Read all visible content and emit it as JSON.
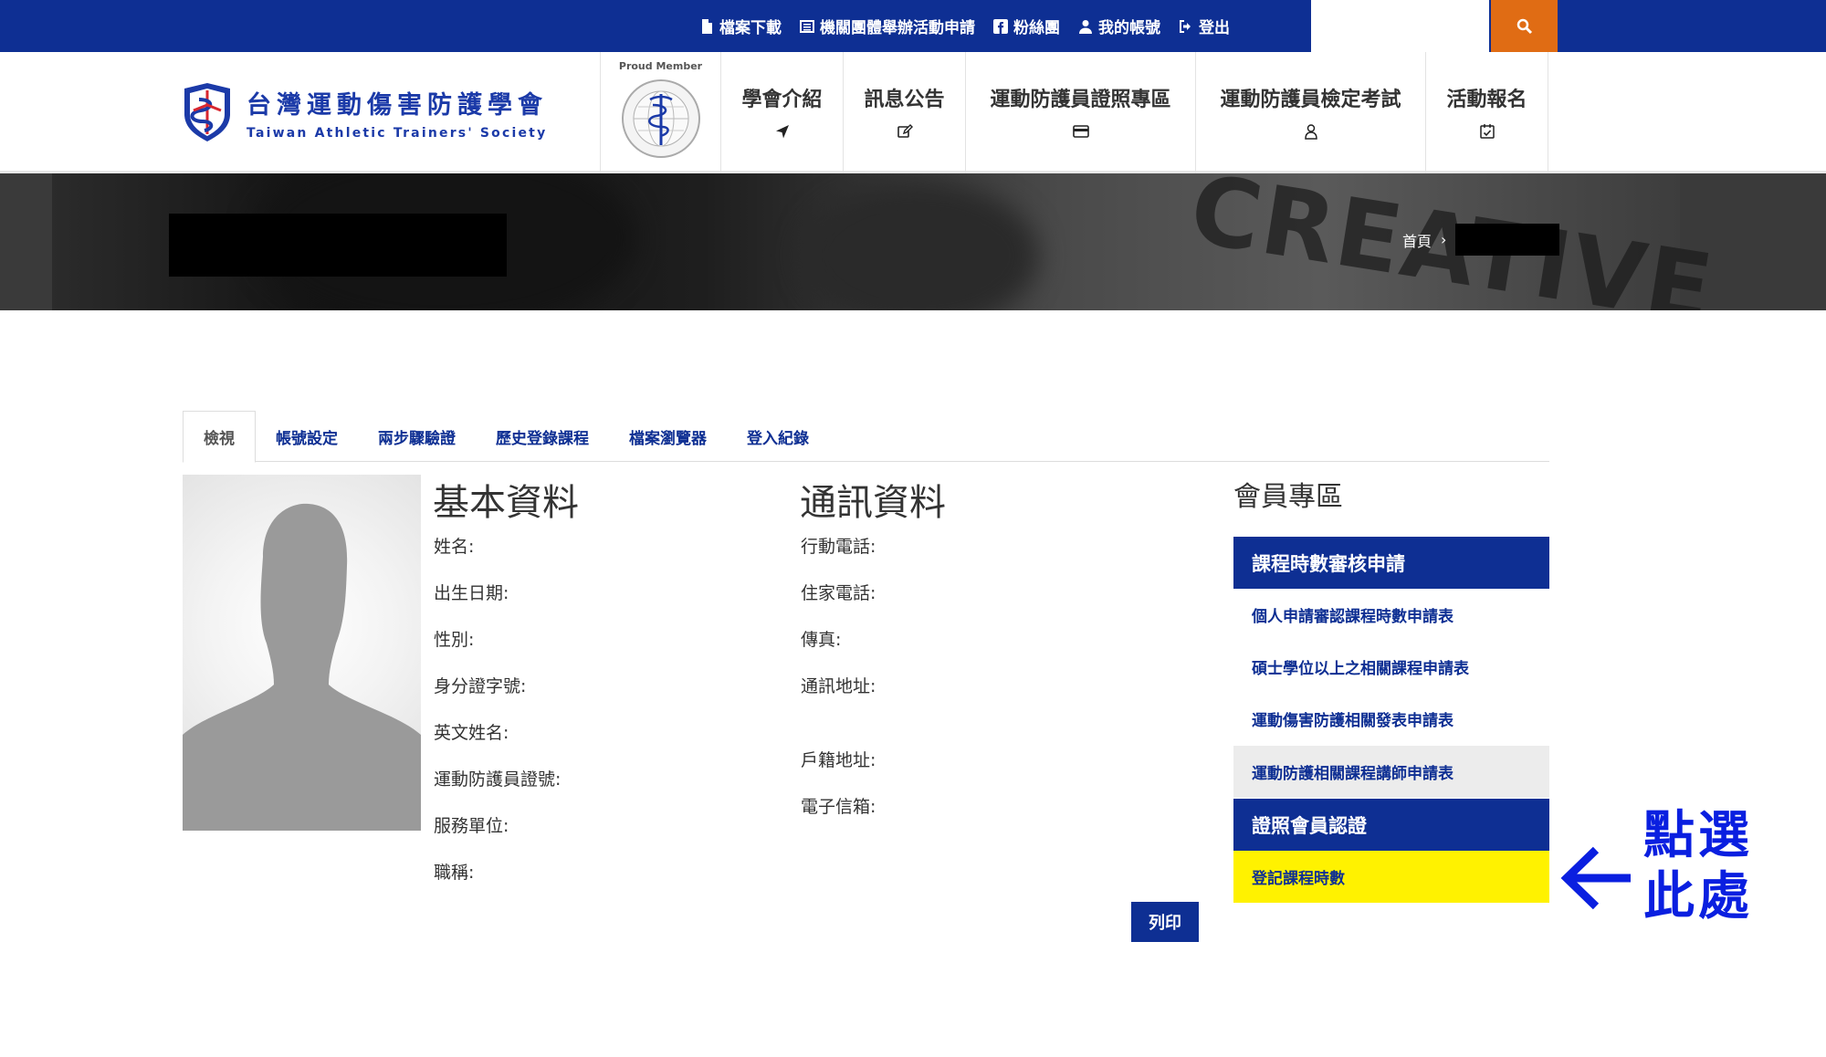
{
  "topbar": {
    "links": [
      {
        "label": "檔案下載",
        "icon": "file-icon"
      },
      {
        "label": "機關團體舉辦活動申請",
        "icon": "list-icon"
      },
      {
        "label": "粉絲團",
        "icon": "facebook-icon"
      },
      {
        "label": "我的帳號",
        "icon": "user-icon"
      },
      {
        "label": "登出",
        "icon": "logout-icon"
      }
    ],
    "search_placeholder": "",
    "search_icon": "search-icon"
  },
  "header": {
    "logo_zh": "台灣運動傷害防護學會",
    "logo_en": "Taiwan Athletic Trainers' Society",
    "proud_member": "Proud Member",
    "nav": [
      {
        "label": "學會介紹",
        "icon": "location-arrow-icon"
      },
      {
        "label": "訊息公告",
        "icon": "edit-icon"
      },
      {
        "label": "運動防護員證照專區",
        "icon": "credit-card-icon"
      },
      {
        "label": "運動防護員檢定考試",
        "icon": "user-outline-icon"
      },
      {
        "label": "活動報名",
        "icon": "calendar-check-icon"
      }
    ]
  },
  "banner": {
    "background_word": "CREATIVE",
    "breadcrumb_home": "首頁",
    "breadcrumb_sep": "›"
  },
  "tabs": [
    "檢視",
    "帳號設定",
    "兩步驟驗證",
    "歷史登錄課程",
    "檔案瀏覽器",
    "登入紀錄"
  ],
  "profile": {
    "basic_title": "基本資料",
    "basic_fields": [
      "姓名:",
      "出生日期:",
      "性別:",
      "身分證字號:",
      "英文姓名:",
      "運動防護員證號:",
      "服務單位:",
      "職稱:"
    ],
    "contact_title": "通訊資料",
    "contact_fields": [
      "行動電話:",
      "住家電話:",
      "傳真:",
      "通訊地址:",
      "戶籍地址:",
      "電子信箱:"
    ],
    "print_label": "列印"
  },
  "sidebar": {
    "title": "會員專區",
    "section1_title": "課程時數審核申請",
    "section1_links": [
      "個人申請審認課程時數申請表",
      "碩士學位以上之相關課程申請表",
      "運動傷害防護相關發表申請表",
      "運動防護相關課程講師申請表"
    ],
    "section2_title": "證照會員認證",
    "section2_links": [
      "登記課程時數"
    ]
  },
  "annotation": {
    "line1": "點選",
    "line2": "此處"
  },
  "colors": {
    "primary": "#0e2f93",
    "search_button": "#e06c14",
    "highlight": "#fff200",
    "annotation": "#0a1fe0"
  }
}
